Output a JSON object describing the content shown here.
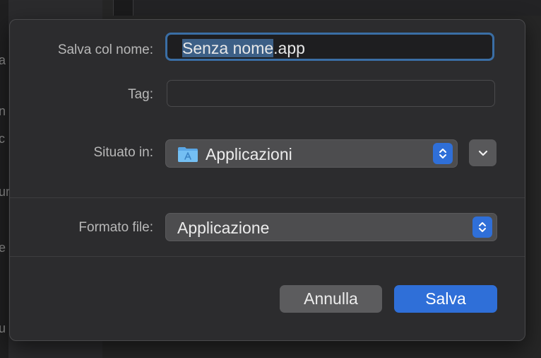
{
  "dialog": {
    "save_as_label": "Salva col nome:",
    "file_name_selected": "Senza nome",
    "file_name_rest": ".app",
    "tags_label": "Tag:",
    "tags_value": "",
    "location_label": "Situato in:",
    "location_value": "Applicazioni",
    "format_label": "Formato file:",
    "format_value": "Applicazione",
    "cancel_label": "Annulla",
    "save_label": "Salva"
  },
  "background": {
    "edge_letters": [
      "a",
      "n",
      "c",
      "ur",
      "e",
      "u"
    ]
  },
  "colors": {
    "accent": "#2f6fd8",
    "focus_ring": "#3a6ea5",
    "dialog_bg": "#2c2c2e"
  },
  "icons": {
    "location": "folder-applications-icon",
    "stepper": "up-down-chevron-icon",
    "expand": "chevron-down-icon"
  }
}
